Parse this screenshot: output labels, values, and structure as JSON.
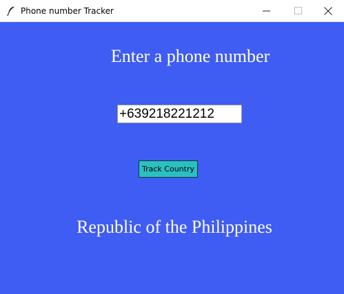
{
  "window": {
    "title": "Phone number Tracker",
    "icon": "feather-icon",
    "controls": [
      "minimize-icon",
      "maximize-icon",
      "close-icon"
    ]
  },
  "main": {
    "heading": "Enter a phone number",
    "phone_input": {
      "value": "+639218221212"
    },
    "track_button_label": "Track Country",
    "result_text": "Republic of the Philippines"
  },
  "colors": {
    "background": "#3f5cf3",
    "button": "#2ac0c0",
    "text": "#ffffff"
  }
}
